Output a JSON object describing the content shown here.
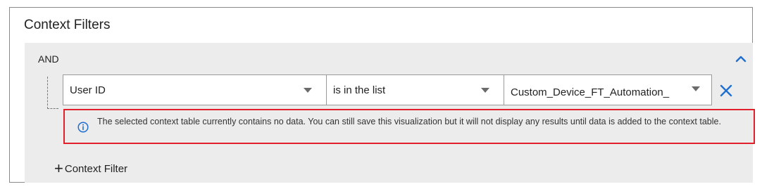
{
  "panel": {
    "title": "Context Filters"
  },
  "group": {
    "operator": "AND",
    "collapse_icon": "chevron-up-icon",
    "rule": {
      "field": "User ID",
      "operator": "is in the list",
      "value": "Custom_Device_FT_Automation_",
      "remove_icon": "close-icon"
    },
    "notice": {
      "icon": "info-icon",
      "text": "The selected context table currently contains no data. You can still save this visualization but it will not display any results until data is added to the context table."
    },
    "add_filter": {
      "plus": "+",
      "label": "Context Filter"
    }
  },
  "colors": {
    "accent": "#1f6fd1",
    "notice_border": "#e0202a",
    "group_background": "#ececec"
  }
}
